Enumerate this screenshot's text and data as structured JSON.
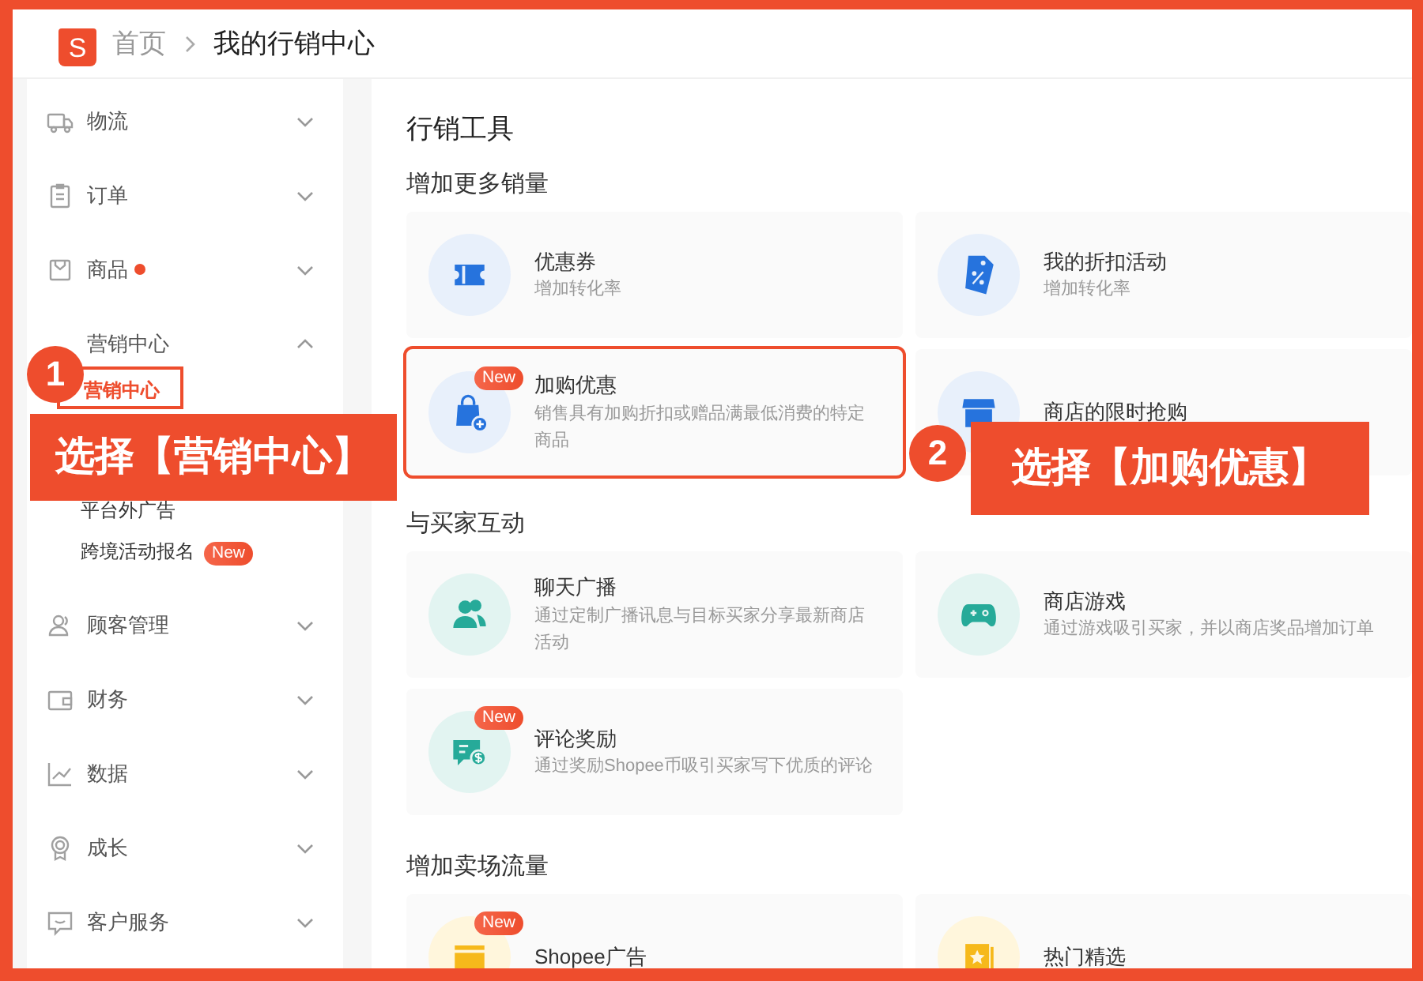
{
  "header": {
    "logo_letter": "S",
    "breadcrumb": [
      {
        "label": "首页",
        "current": false
      },
      {
        "label": "我的行销中心",
        "current": true
      }
    ]
  },
  "sidebar": {
    "items": [
      {
        "label": "物流",
        "expanded": false,
        "dot": false
      },
      {
        "label": "订单",
        "expanded": false,
        "dot": false
      },
      {
        "label": "商品",
        "expanded": false,
        "dot": true
      },
      {
        "label": "营销中心",
        "expanded": true,
        "dot": false,
        "children": [
          {
            "label": "营销中心",
            "selected": true,
            "annotation": {
              "number": "1",
              "text": "选择【营销中心】"
            }
          },
          {
            "label": "平台外广告",
            "selected": false
          },
          {
            "label": "跨境活动报名",
            "selected": false,
            "tag": "New"
          }
        ]
      },
      {
        "label": "顾客管理",
        "expanded": false,
        "dot": false
      },
      {
        "label": "财务",
        "expanded": false,
        "dot": false
      },
      {
        "label": "数据",
        "expanded": false,
        "dot": false
      },
      {
        "label": "成长",
        "expanded": false,
        "dot": false
      },
      {
        "label": "客户服务",
        "expanded": false,
        "dot": false
      }
    ]
  },
  "main": {
    "title": "行销工具",
    "sections": [
      {
        "title": "增加更多销量",
        "cards": [
          {
            "title": "优惠券",
            "description": "增加转化率"
          },
          {
            "title": "我的折扣活动",
            "description": "增加转化率"
          },
          {
            "title": "加购优惠",
            "description": "销售具有加购折扣或赠品满最低消费的特定商品",
            "tag": "New",
            "annotation": {
              "number": "2",
              "text": "选择【加购优惠】"
            }
          },
          {
            "title": "商店的限时抢购"
          }
        ]
      },
      {
        "title": "与买家互动",
        "cards": [
          {
            "title": "聊天广播",
            "description": "通过定制广播讯息与目标买家分享最新商店活动"
          },
          {
            "title": "商店游戏",
            "description": "通过游戏吸引买家，并以商店奖品增加订单"
          },
          {
            "title": "评论奖励",
            "description": "通过奖励Shopee币吸引买家写下优质的评论",
            "tag": "New"
          }
        ]
      },
      {
        "title": "增加卖场流量",
        "cards": [
          {
            "title": "Shopee广告",
            "tag": "New"
          },
          {
            "title": "热门精选"
          }
        ]
      }
    ]
  }
}
